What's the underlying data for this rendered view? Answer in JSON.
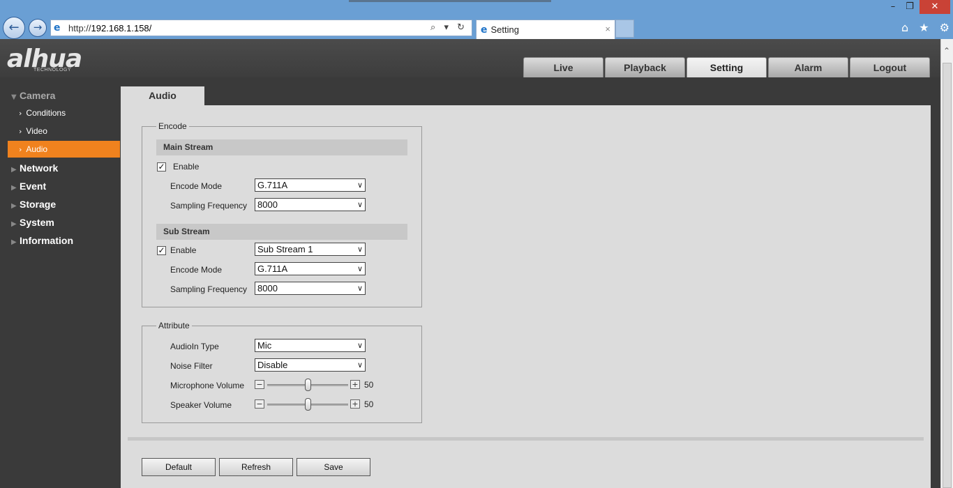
{
  "browser": {
    "url_prefix": "http://",
    "url_host": "192.168.1.158/",
    "tab_title": "Setting",
    "tab_close": "×",
    "tools": "⌕ ▾ ↻",
    "window": {
      "minimize": "–",
      "maximize": "❐",
      "close": "✕"
    },
    "right_icons": "⌂ ★ ⚙"
  },
  "app": {
    "logo": "alhua",
    "logo_sub": "TECHNOLOGY",
    "tabs": [
      {
        "label": "Live"
      },
      {
        "label": "Playback"
      },
      {
        "label": "Setting",
        "active": true
      },
      {
        "label": "Alarm"
      },
      {
        "label": "Logout"
      }
    ]
  },
  "sidebar": {
    "groups": [
      {
        "label": "Camera",
        "open": true
      },
      {
        "label": "Network"
      },
      {
        "label": "Event"
      },
      {
        "label": "Storage"
      },
      {
        "label": "System"
      },
      {
        "label": "Information"
      }
    ],
    "camera_items": [
      {
        "label": "Conditions"
      },
      {
        "label": "Video"
      },
      {
        "label": "Audio",
        "active": true
      }
    ]
  },
  "content": {
    "tab": "Audio",
    "encode": {
      "legend": "Encode",
      "main_stream": {
        "title": "Main Stream",
        "enable_label": "Enable",
        "enabled": true,
        "encode_mode_label": "Encode Mode",
        "encode_mode": "G.711A",
        "sampling_label": "Sampling Frequency",
        "sampling": "8000"
      },
      "sub_stream": {
        "title": "Sub Stream",
        "enable_label": "Enable",
        "enabled": true,
        "stream_select": "Sub Stream 1",
        "encode_mode_label": "Encode Mode",
        "encode_mode": "G.711A",
        "sampling_label": "Sampling Frequency",
        "sampling": "8000"
      }
    },
    "attribute": {
      "legend": "Attribute",
      "audioin_label": "AudioIn Type",
      "audioin": "Mic",
      "noise_label": "Noise Filter",
      "noise": "Disable",
      "mic_volume_label": "Microphone Volume",
      "mic_volume": "50",
      "speaker_volume_label": "Speaker Volume",
      "speaker_volume": "50"
    },
    "buttons": {
      "default": "Default",
      "refresh": "Refresh",
      "save": "Save"
    }
  },
  "glyphs": {
    "check": "✓",
    "dropdown": "∨",
    "minus": "−",
    "plus": "+",
    "chevron_right": "›",
    "arrow_down": "▼",
    "arrow_right": "▶"
  },
  "colors": {
    "accent": "#f0821e",
    "browser_bar": "#6a9fd4",
    "app_dark": "#3a3a3a",
    "panel": "#dcdcdc"
  }
}
